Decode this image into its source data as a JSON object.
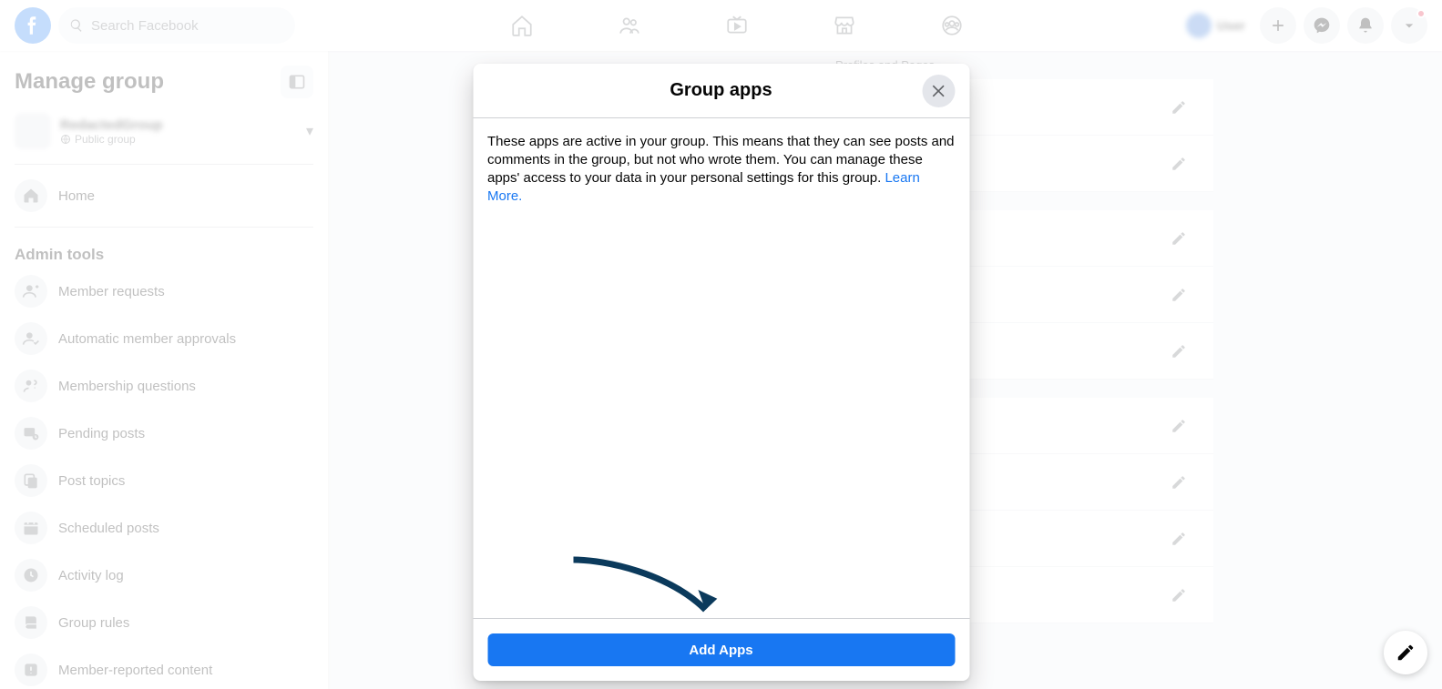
{
  "header": {
    "search_placeholder": "Search Facebook",
    "profile_name": "User"
  },
  "sidebar": {
    "title": "Manage group",
    "group_name": "RedactedGroup",
    "group_privacy": "Public group",
    "home": "Home",
    "section_admin": "Admin tools",
    "items": [
      "Member requests",
      "Automatic member approvals",
      "Membership questions",
      "Pending posts",
      "Post topics",
      "Scheduled posts",
      "Activity log",
      "Group rules",
      "Member-reported content"
    ]
  },
  "main": {
    "tab": "Profiles and Pages"
  },
  "modal": {
    "title": "Group apps",
    "body_text": "These apps are active in your group. This means that they can see posts and comments in the group, but not who wrote them. You can manage these apps' access to your data in your personal settings for this group. ",
    "learn_more": "Learn More.",
    "add_button": "Add Apps"
  }
}
